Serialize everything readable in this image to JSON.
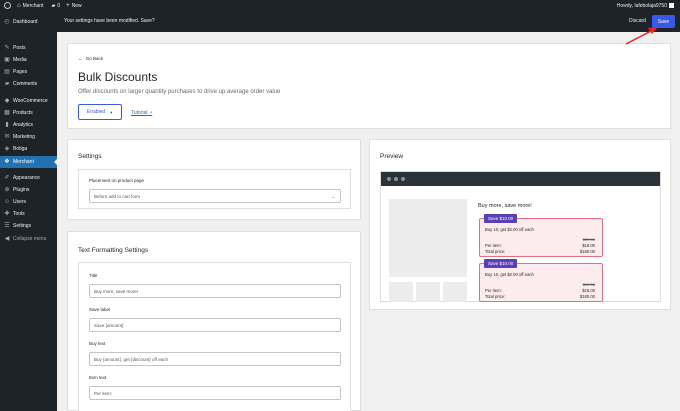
{
  "admin_bar": {
    "site_name": "Merchant",
    "comments_count": "0",
    "new_label": "New",
    "howdy": "Howdy, lafebolaja9750"
  },
  "sidebar": {
    "items": [
      {
        "label": "Dashboard",
        "icon": "dashboard-icon"
      },
      {
        "label": "Posts",
        "icon": "pin-icon"
      },
      {
        "label": "Media",
        "icon": "media-icon"
      },
      {
        "label": "Pages",
        "icon": "page-icon"
      },
      {
        "label": "Comments",
        "icon": "comment-icon"
      },
      {
        "label": "WooCommerce",
        "icon": "woo-icon"
      },
      {
        "label": "Products",
        "icon": "box-icon"
      },
      {
        "label": "Analytics",
        "icon": "chart-icon"
      },
      {
        "label": "Marketing",
        "icon": "megaphone-icon"
      },
      {
        "label": "Botiga",
        "icon": "theme-icon"
      },
      {
        "label": "Merchant",
        "icon": "merchant-icon"
      },
      {
        "label": "Appearance",
        "icon": "brush-icon"
      },
      {
        "label": "Plugins",
        "icon": "plugin-icon"
      },
      {
        "label": "Users",
        "icon": "users-icon"
      },
      {
        "label": "Tools",
        "icon": "wrench-icon"
      },
      {
        "label": "Settings",
        "icon": "settings-icon"
      },
      {
        "label": "Collapse menu",
        "icon": "collapse-icon"
      }
    ]
  },
  "notice": {
    "text": "Your settings have been modified. Save?",
    "discard_label": "Discard",
    "save_label": "Save"
  },
  "header": {
    "back_label": "Go Back",
    "title": "Bulk Discounts",
    "subtitle": "Offer discounts on larger quantity purchases to drive up average order value",
    "status_label": "Enabled",
    "tutorial_label": "Tutorial"
  },
  "settings": {
    "title": "Settings",
    "placement_label": "Placement on product page",
    "placement_value": "Before add to cart form"
  },
  "text_formatting": {
    "title": "Text Formatting Settings",
    "fields": [
      {
        "label": "Title",
        "value": "Buy more, save more!"
      },
      {
        "label": "Save label",
        "value": "Save {amount}"
      },
      {
        "label": "Buy text",
        "value": "Buy {amount}, get {discount} off each"
      },
      {
        "label": "Item text",
        "value": "Per item:"
      }
    ]
  },
  "preview": {
    "title": "Preview",
    "headline": "Buy more, save more!",
    "offers": [
      {
        "badge": "Save $10.00",
        "buy": "Buy 10, get $2.00 off each",
        "old_price": "$20.00",
        "per_item_label": "Per item:",
        "per_item_value": "$18.00",
        "total_label": "Total price:",
        "total_value": "$180.00"
      },
      {
        "badge": "Save $10.00",
        "buy": "Buy 10, get $2.00 off each",
        "old_price": "$20.00",
        "per_item_label": "Per item:",
        "per_item_value": "$18.00",
        "total_label": "Total price:",
        "total_value": "$180.00"
      }
    ]
  },
  "colors": {
    "admin_dark": "#1d2327",
    "accent_blue": "#3858e9",
    "active_menu": "#2271b1",
    "badge_purple": "#5a3fb5",
    "offer_border": "#e26f80",
    "offer_bg": "#fdecee",
    "annotation_red": "#e8251c"
  }
}
